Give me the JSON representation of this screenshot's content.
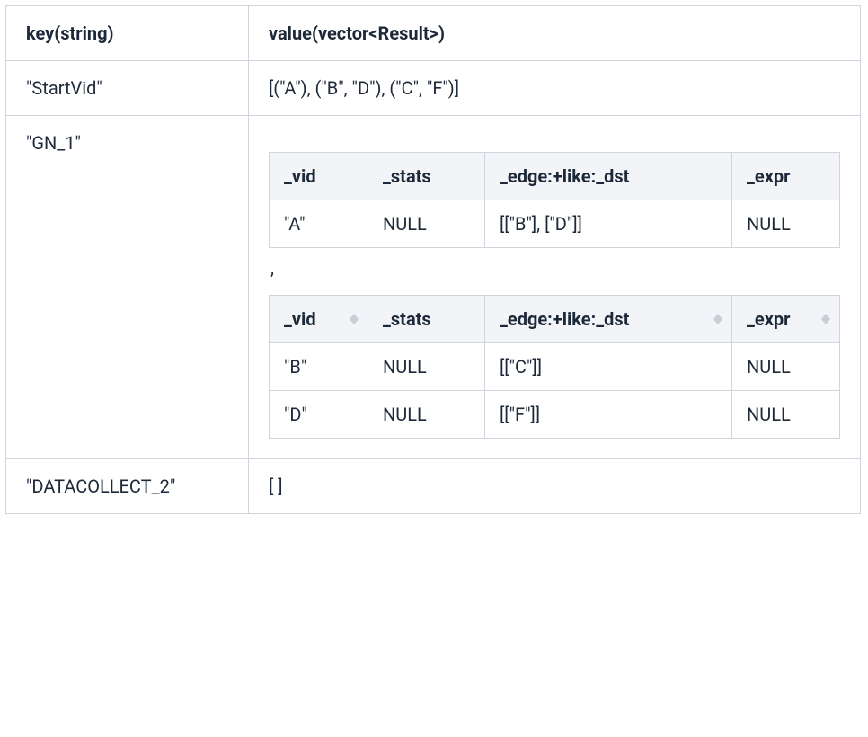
{
  "outer": {
    "headers": [
      "key(string)",
      "value(vector<Result>)"
    ]
  },
  "rows": {
    "row0": {
      "key": "\"StartVid\"",
      "value": "[(\"A\"),  (\"B\", \"D\"), (\"C\", \"F\")]"
    },
    "row1": {
      "key": "\"GN_1\"",
      "inner1": {
        "headers": [
          "_vid",
          "_stats",
          "_edge:+like:_dst",
          "_expr"
        ],
        "r0": [
          "\"A\"",
          "NULL",
          "[[\"B\"], [\"D\"]]",
          "NULL"
        ]
      },
      "separator": ",",
      "inner2": {
        "headers": [
          "_vid",
          "_stats",
          "_edge:+like:_dst",
          "_expr"
        ],
        "r0": [
          "\"B\"",
          "NULL",
          "[[\"C\"]]",
          "NULL"
        ],
        "r1": [
          "\"D\"",
          "NULL",
          "[[\"F\"]]",
          "NULL"
        ]
      }
    },
    "row2": {
      "key": "\"DATACOLLECT_2\"",
      "value": "[ ]"
    }
  }
}
